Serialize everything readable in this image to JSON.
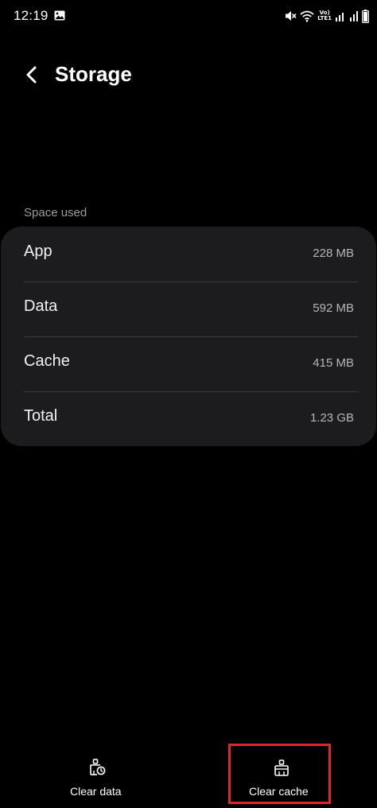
{
  "status_bar": {
    "time": "12:19",
    "lte_line1": "Vo)",
    "lte_line2": "LTE1",
    "icons": [
      "gallery-icon",
      "mute-icon",
      "wifi-icon",
      "signal-icon",
      "battery-icon"
    ]
  },
  "header": {
    "back_icon": "chevron-left-icon",
    "title": "Storage"
  },
  "storage": {
    "section_label": "Space used",
    "rows": [
      {
        "label": "App",
        "value": "228 MB"
      },
      {
        "label": "Data",
        "value": "592 MB"
      },
      {
        "label": "Cache",
        "value": "415 MB"
      },
      {
        "label": "Total",
        "value": "1.23 GB"
      }
    ]
  },
  "actions": {
    "clear_data": {
      "label": "Clear data",
      "icon": "clear-data-icon"
    },
    "clear_cache": {
      "label": "Clear cache",
      "icon": "clear-cache-icon"
    }
  },
  "colors": {
    "background": "#000000",
    "card": "#1c1c1e",
    "highlight_border": "#e0262b",
    "secondary_text": "#9a9a9a"
  }
}
